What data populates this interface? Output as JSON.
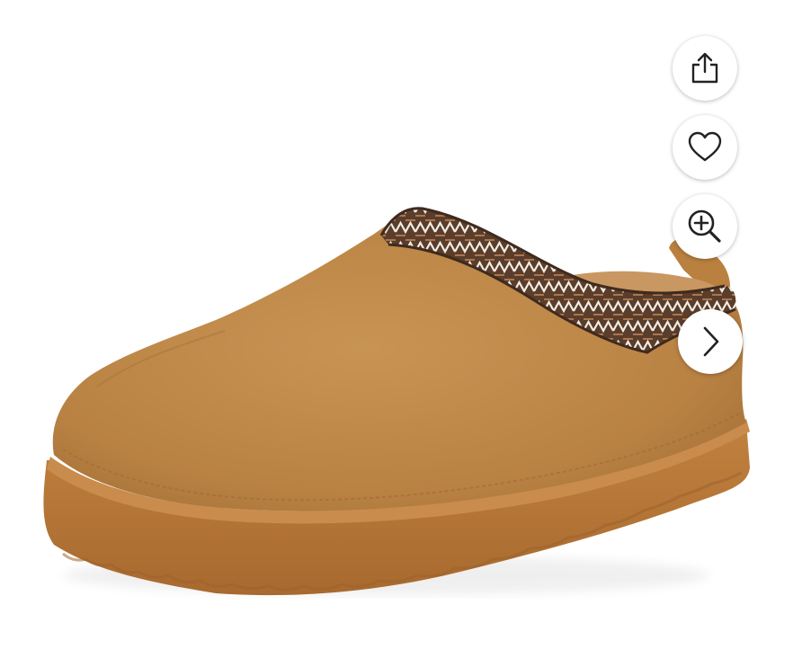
{
  "product_gallery": {
    "image_alt": "",
    "actions": [
      {
        "id": "share",
        "icon": "share-icon"
      },
      {
        "id": "favorite",
        "icon": "heart-icon"
      },
      {
        "id": "zoom",
        "icon": "zoom-in-icon"
      },
      {
        "id": "next",
        "icon": "chevron-right-icon"
      }
    ]
  },
  "colors": {
    "suede": "#c08a48",
    "sole": "#b7773a",
    "trim_dark": "#5a3d2b",
    "icon": "#222222",
    "button_bg": "#ffffff"
  }
}
